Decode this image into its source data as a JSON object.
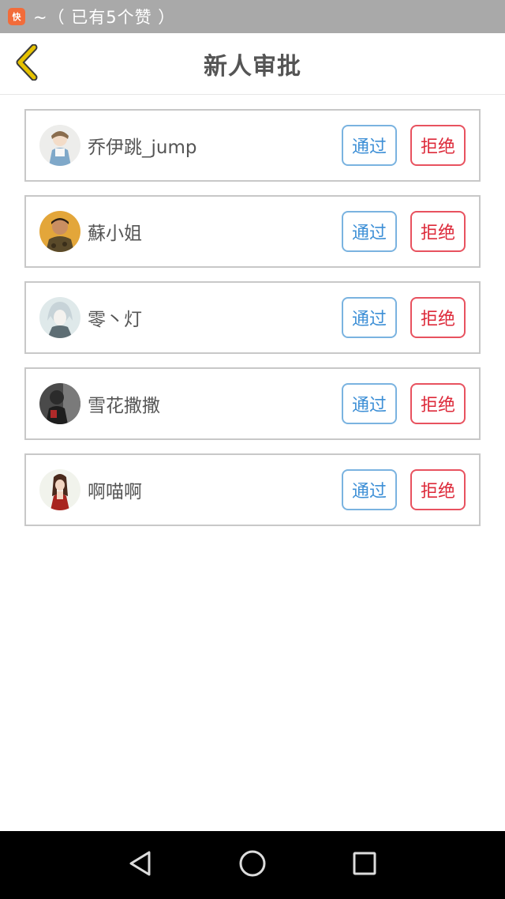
{
  "status_bar": {
    "app_icon": "kuaikan-app-icon",
    "app_icon_text": "快",
    "notification_text": "~（ 已有5个赞 ）"
  },
  "header": {
    "title": "新人审批",
    "back_icon": "chevron-left-icon"
  },
  "colors": {
    "approve": "#3d8fd6",
    "reject": "#dd2a3a",
    "back_icon": "#c9a300"
  },
  "requests": [
    {
      "name": "乔伊跳_jump",
      "approve_label": "通过",
      "reject_label": "拒绝"
    },
    {
      "name": "蘇小姐",
      "approve_label": "通过",
      "reject_label": "拒绝"
    },
    {
      "name": "零丶灯",
      "approve_label": "通过",
      "reject_label": "拒绝"
    },
    {
      "name": "雪花撒撒",
      "approve_label": "通过",
      "reject_label": "拒绝"
    },
    {
      "name": "啊喵啊",
      "approve_label": "通过",
      "reject_label": "拒绝"
    }
  ],
  "system_nav": {
    "back": "triangle-back-icon",
    "home": "circle-home-icon",
    "recents": "square-recents-icon"
  }
}
